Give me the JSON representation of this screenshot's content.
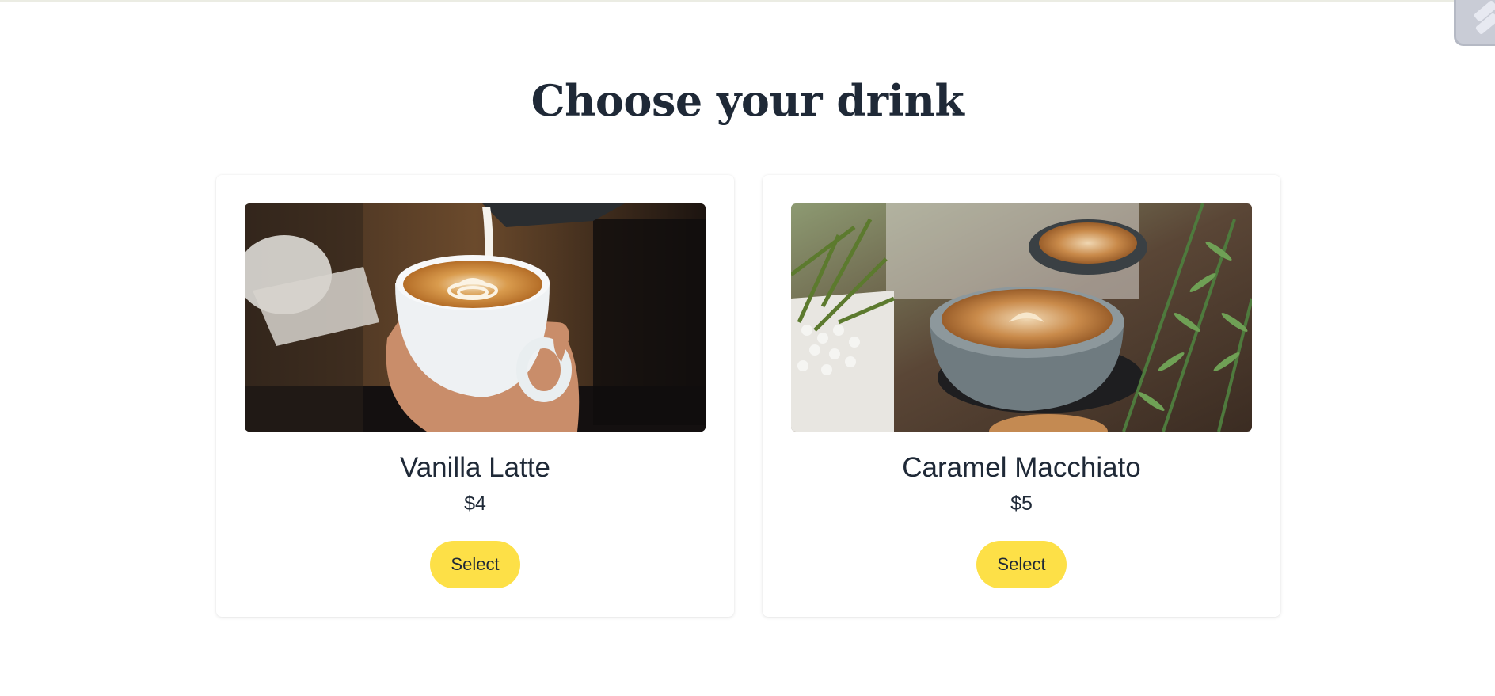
{
  "page": {
    "title": "Choose your drink"
  },
  "drinks": [
    {
      "name": "Vanilla Latte",
      "price": "$4",
      "select_label": "Select",
      "image": "latte-art-pour-photo"
    },
    {
      "name": "Caramel Macchiato",
      "price": "$5",
      "select_label": "Select",
      "image": "coffee-cups-with-plants-photo"
    }
  ],
  "colors": {
    "accent": "#fde047",
    "text": "#1f2937",
    "background": "#ffffff"
  }
}
